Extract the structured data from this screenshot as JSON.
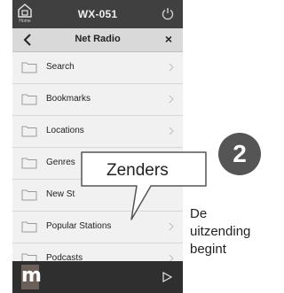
{
  "topbar": {
    "device_name": "WX-051",
    "home_label": "Home",
    "home_icon": "home-icon",
    "power_icon": "power-icon"
  },
  "navbar": {
    "title": "Net Radio",
    "back_icon": "chevron-left-icon",
    "close_label": "×"
  },
  "list": {
    "items": [
      {
        "label": "Search"
      },
      {
        "label": "Bookmarks"
      },
      {
        "label": "Locations"
      },
      {
        "label": "Genres"
      },
      {
        "label": "New St"
      },
      {
        "label": "Popular Stations"
      },
      {
        "label": "Podcasts"
      }
    ]
  },
  "player": {
    "logo_letter": "m",
    "play_icon": "play-icon"
  },
  "annotation": {
    "callout_text": "Zenders",
    "step_number": "2",
    "description_lines": [
      "De",
      "uitzending",
      "begint"
    ]
  },
  "colors": {
    "topbar": "#404040",
    "navbar": "#d9d9d9",
    "list_bg": "#f1f1f1",
    "player": "#2f2f2f",
    "badge": "#555555"
  }
}
